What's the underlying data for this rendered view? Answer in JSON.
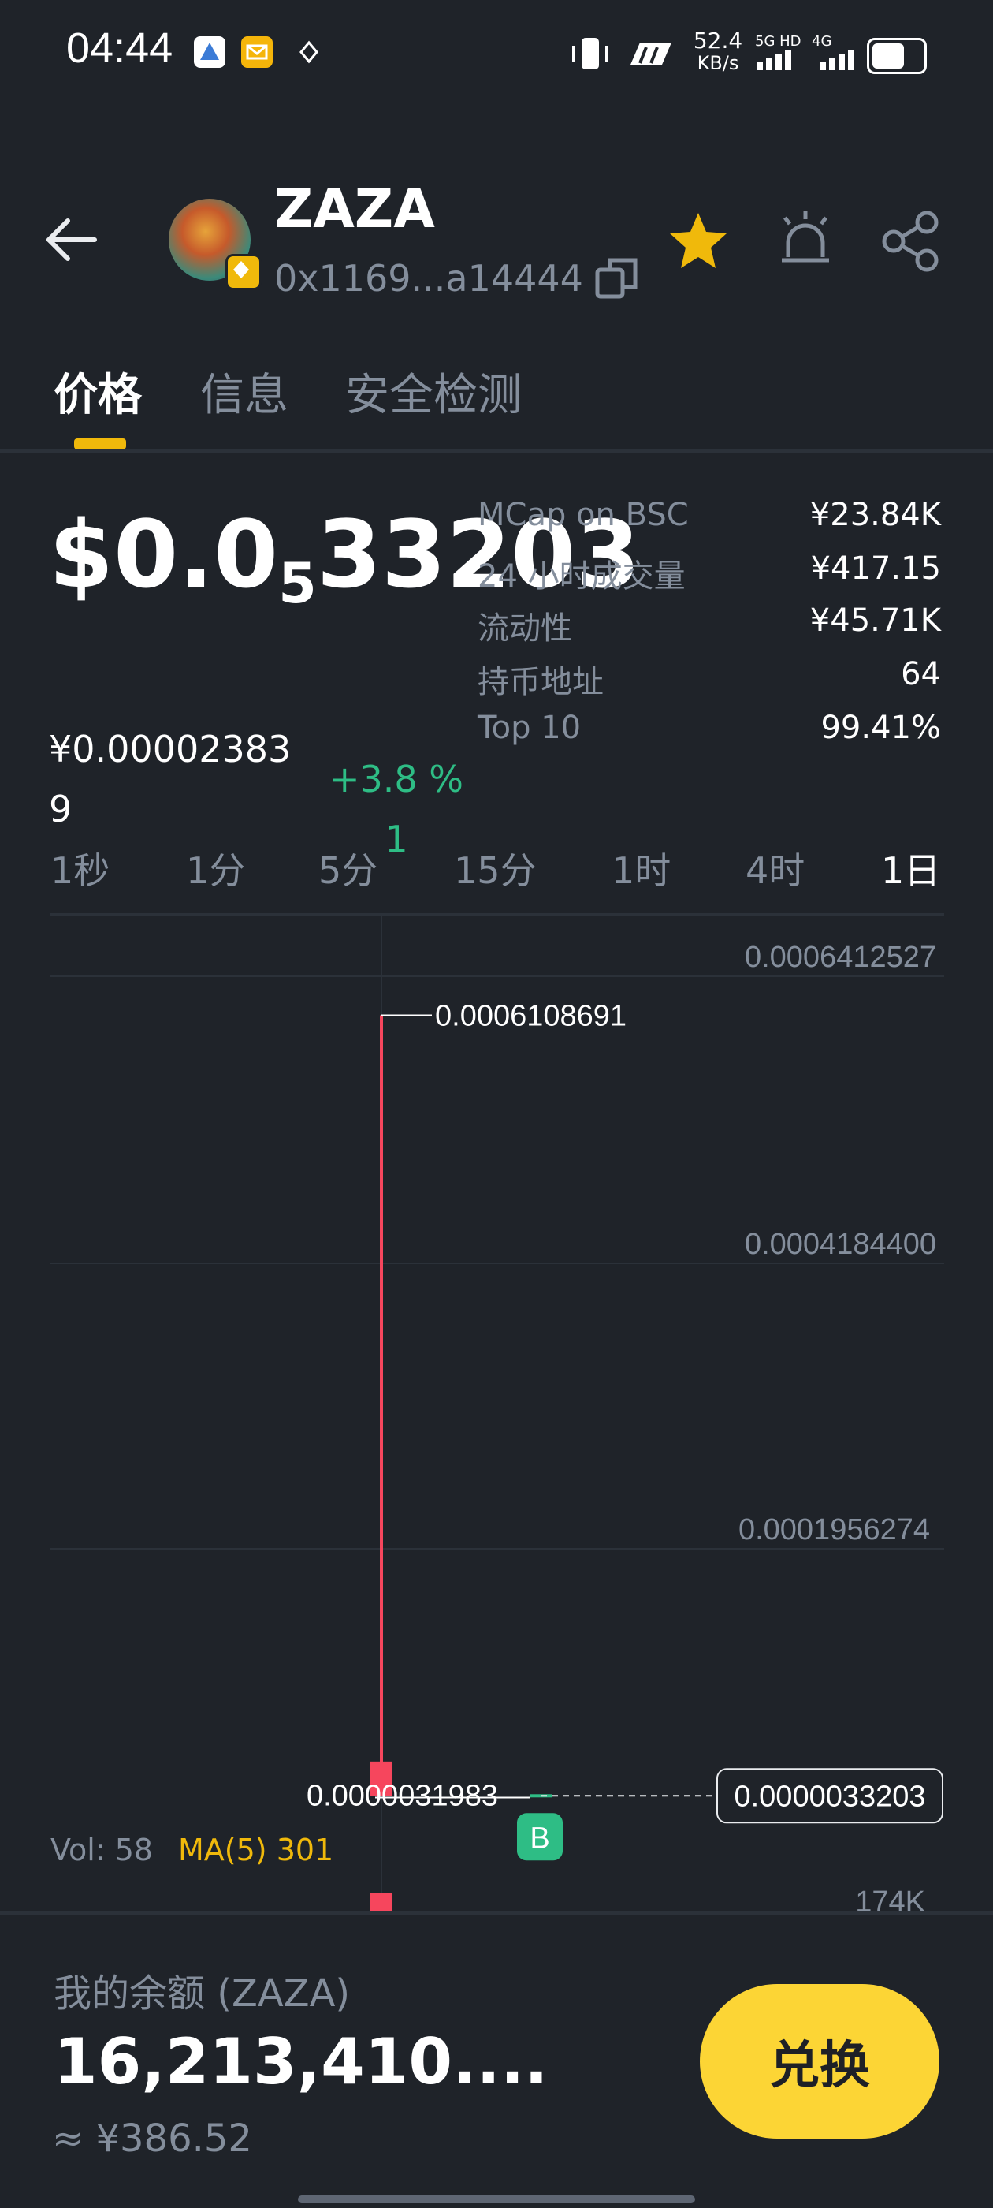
{
  "status_bar": {
    "time": "04:44",
    "net_speed_value": "52.4",
    "net_speed_unit": "KB/s",
    "signal_1": "5G HD",
    "signal_2": "4G"
  },
  "header": {
    "token_name": "ZAZA",
    "token_address": "0x1169...a14444",
    "back_icon": "arrow-left-icon",
    "copy_icon": "copy-icon",
    "favorite_icon": "star-icon",
    "alert_icon": "alert-icon",
    "share_icon": "share-icon",
    "accent_color": "#f0b90b"
  },
  "tabs": [
    {
      "label": "价格",
      "active": true
    },
    {
      "label": "信息",
      "active": false
    },
    {
      "label": "安全检测",
      "active": false
    }
  ],
  "price": {
    "usd_prefix": "$0.0",
    "usd_sub": "5",
    "usd_rest": "33203",
    "cny": "¥0.000023839",
    "change": "+3.8 %1",
    "change_color": "#2ebd85"
  },
  "stats": [
    {
      "label": "MCap on BSC",
      "value": "¥23.84K"
    },
    {
      "label": "24 小时成交量",
      "value": "¥417.15"
    },
    {
      "label": "流动性",
      "value": "¥45.71K"
    },
    {
      "label": "持币地址",
      "value": "64"
    },
    {
      "label": "Top 10",
      "value": "99.41%"
    }
  ],
  "intervals": [
    {
      "label": "1秒",
      "active": false
    },
    {
      "label": "1分",
      "active": false
    },
    {
      "label": "5分",
      "active": false
    },
    {
      "label": "15分",
      "active": false
    },
    {
      "label": "1时",
      "active": false
    },
    {
      "label": "4时",
      "active": false
    },
    {
      "label": "1日",
      "active": true
    }
  ],
  "chart_data": {
    "type": "candlestick",
    "y_axis_labels": [
      "0.0006412527",
      "0.0004184400",
      "0.0001956274"
    ],
    "high_label": "0.0006108691",
    "low_label": "0.0000031983",
    "current_price_label": "0.0000033203",
    "buy_marker": "B",
    "candles": [
      {
        "open": 3e-05,
        "close": 3.1983e-06,
        "high": 0.0006108691,
        "low": 3.1983e-06,
        "color": "#f6465d"
      },
      {
        "open": 3.1983e-06,
        "close": 3.3203e-06,
        "high": 3.4e-06,
        "low": 3.1983e-06,
        "color": "#2ebd85"
      }
    ],
    "volume_axis_label": "174K",
    "grid": true
  },
  "volume": {
    "vol_label": "Vol: 58",
    "ma_label": "MA(5) 301"
  },
  "balance": {
    "label": "我的余额 (ZAZA)",
    "value": "16,213,410....",
    "cny": "≈ ¥386.52"
  },
  "swap_button": {
    "label": "兑换",
    "color": "#fcd535"
  }
}
